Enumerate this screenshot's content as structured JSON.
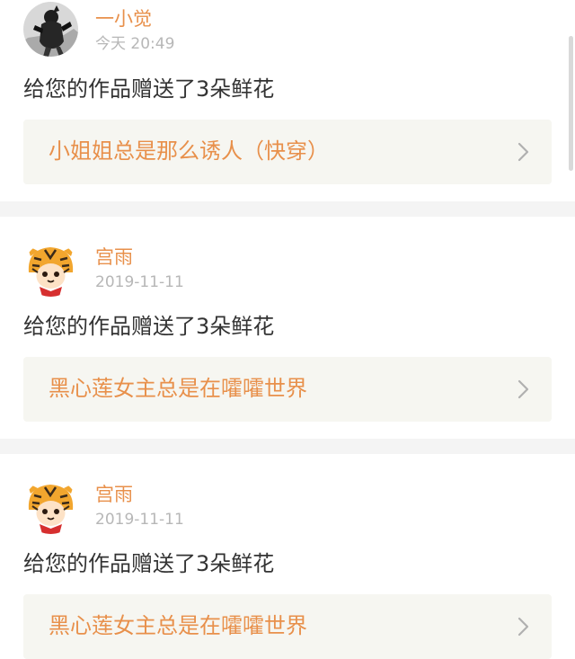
{
  "feed": {
    "items": [
      {
        "username": "一小觉",
        "time": "今天 20:49",
        "message": "给您的作品赠送了3朵鲜花",
        "work_title": "小姐姐总是那么诱人（快穿）",
        "avatar_icon": "dark-figure-avatar-icon"
      },
      {
        "username": "宫雨",
        "time": "2019-11-11",
        "message": "给您的作品赠送了3朵鲜花",
        "work_title": "黑心莲女主总是在嚯嚯世界",
        "avatar_icon": "tiger-hat-avatar-icon"
      },
      {
        "username": "宫雨",
        "time": "2019-11-11",
        "message": "给您的作品赠送了3朵鲜花",
        "work_title": "黑心莲女主总是在嚯嚯世界",
        "avatar_icon": "tiger-hat-avatar-icon"
      }
    ]
  },
  "colors": {
    "accent": "#e8904b",
    "timestamp": "#b7b7b7",
    "message": "#333333",
    "link_background": "#f6f6f1",
    "divider": "#f4f4f4"
  }
}
